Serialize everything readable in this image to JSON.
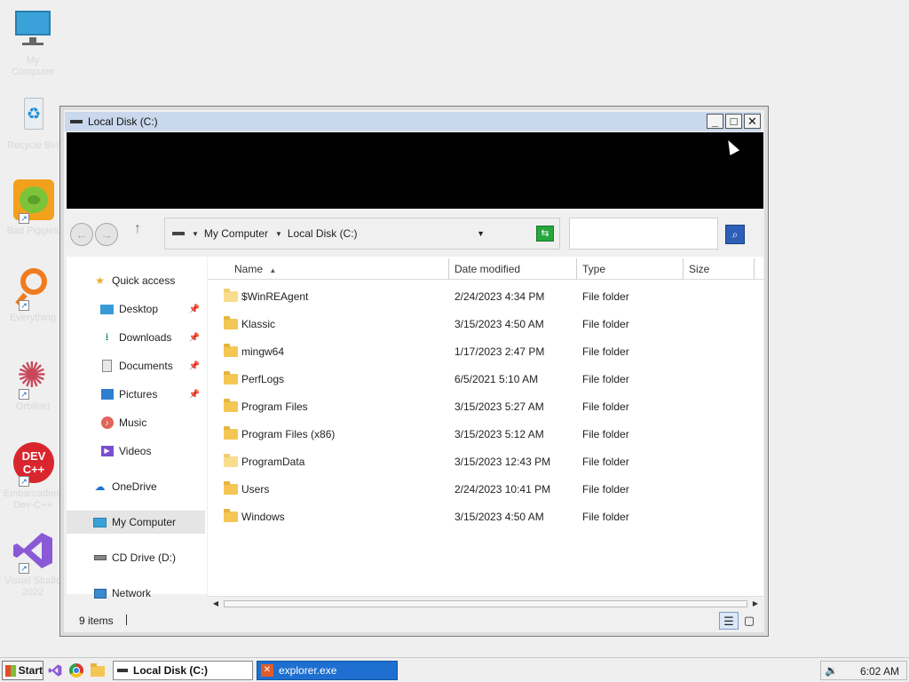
{
  "desktop": {
    "icons": [
      {
        "name": "my-computer",
        "label": "My Computer"
      },
      {
        "name": "recycle-bin",
        "label": "Recycle Bin"
      },
      {
        "name": "bad-piggies",
        "label": "Bad Piggies"
      },
      {
        "name": "everything",
        "label": "Everything"
      },
      {
        "name": "orbifold",
        "label": "Orbifold"
      },
      {
        "name": "dev-cpp",
        "label": "Embarcadero Dev-C++"
      },
      {
        "name": "visual-studio",
        "label": "Visual Studio 2022"
      }
    ]
  },
  "window": {
    "title": "Local Disk (C:)",
    "minimize": "_",
    "maximize": "□",
    "close": "✕"
  },
  "address": {
    "segments": [
      "My Computer",
      "Local Disk (C:)"
    ]
  },
  "search": {
    "placeholder": ""
  },
  "sidebar": {
    "items": [
      {
        "label": "Quick access"
      },
      {
        "label": "Desktop"
      },
      {
        "label": "Downloads"
      },
      {
        "label": "Documents"
      },
      {
        "label": "Pictures"
      },
      {
        "label": "Music"
      },
      {
        "label": "Videos"
      },
      {
        "label": "OneDrive"
      },
      {
        "label": "My Computer"
      },
      {
        "label": "CD Drive (D:)"
      },
      {
        "label": "Network"
      }
    ]
  },
  "list": {
    "columns": {
      "name": "Name",
      "date": "Date modified",
      "type": "Type",
      "size": "Size"
    },
    "rows": [
      {
        "name": "$WinREAgent",
        "date": "2/24/2023 4:34 PM",
        "type": "File folder",
        "faded": true
      },
      {
        "name": "Klassic",
        "date": "3/15/2023 4:50 AM",
        "type": "File folder",
        "faded": false
      },
      {
        "name": "mingw64",
        "date": "1/17/2023 2:47 PM",
        "type": "File folder",
        "faded": false
      },
      {
        "name": "PerfLogs",
        "date": "6/5/2021 5:10 AM",
        "type": "File folder",
        "faded": false
      },
      {
        "name": "Program Files",
        "date": "3/15/2023 5:27 AM",
        "type": "File folder",
        "faded": false
      },
      {
        "name": "Program Files (x86)",
        "date": "3/15/2023 5:12 AM",
        "type": "File folder",
        "faded": false
      },
      {
        "name": "ProgramData",
        "date": "3/15/2023 12:43 PM",
        "type": "File folder",
        "faded": true
      },
      {
        "name": "Users",
        "date": "2/24/2023 10:41 PM",
        "type": "File folder",
        "faded": false
      },
      {
        "name": "Windows",
        "date": "3/15/2023 4:50 AM",
        "type": "File folder",
        "faded": false
      }
    ]
  },
  "status": {
    "items_count": "9 items"
  },
  "taskbar": {
    "start_label": "Start",
    "tasks": [
      {
        "label": "Local Disk (C:)"
      },
      {
        "label": "explorer.exe"
      }
    ],
    "clock": "6:02 AM"
  }
}
